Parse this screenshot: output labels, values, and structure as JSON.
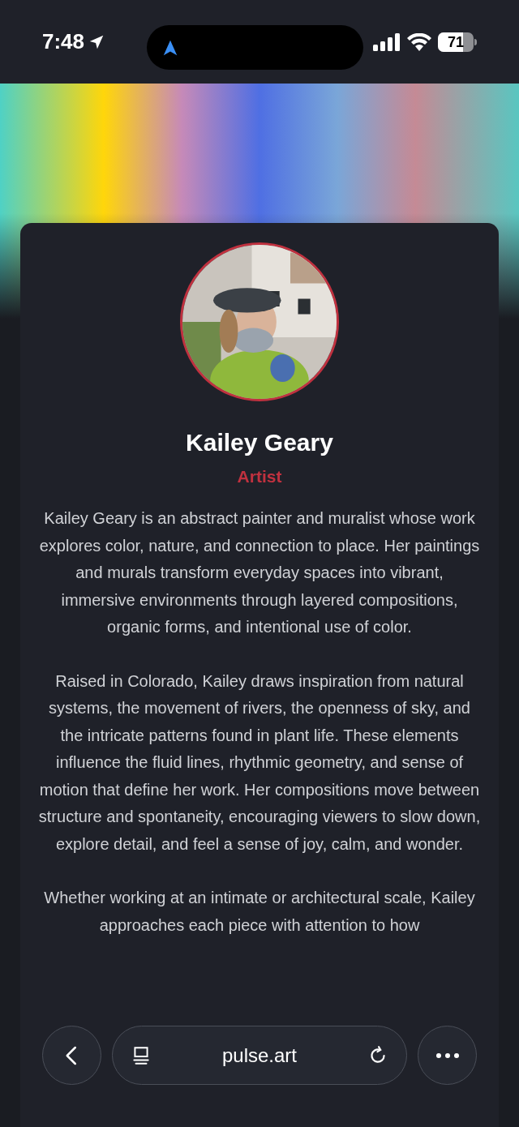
{
  "status_bar": {
    "time": "7:48",
    "battery": "71"
  },
  "profile": {
    "name": "Kailey Geary",
    "role": "Artist",
    "paragraphs": [
      "Kailey Geary is an abstract painter and muralist whose work explores color, nature, and connection to place. Her paintings and murals transform everyday spaces into vibrant, immersive environments through layered compositions, organic forms, and intentional use of color.",
      "Raised in Colorado, Kailey draws inspiration from natural systems, the movement of rivers, the openness of sky, and the intricate patterns found in plant life. These elements influence the fluid lines, rhythmic geometry, and sense of motion that define her work. Her compositions move between structure and spontaneity, encouraging viewers to slow down, explore detail, and feel a sense of joy, calm, and wonder.",
      "Whether working at an intimate or architectural scale, Kailey approaches each piece with attention to how"
    ]
  },
  "browser_bar": {
    "url": "pulse.art"
  }
}
